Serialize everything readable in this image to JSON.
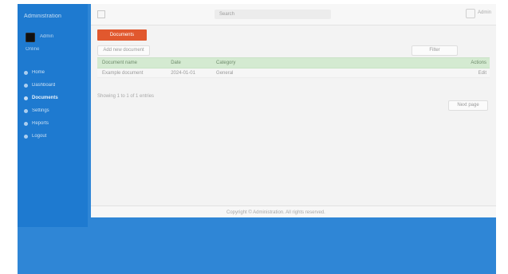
{
  "app": {
    "brand": "Administration"
  },
  "user": {
    "name": "Admin",
    "sub": "Online"
  },
  "sidebar": {
    "items": [
      {
        "label": "Home"
      },
      {
        "label": "Dashboard"
      },
      {
        "label": "Documents"
      },
      {
        "label": "Settings"
      },
      {
        "label": "Reports"
      },
      {
        "label": "Logout"
      }
    ]
  },
  "topbar": {
    "search_placeholder": "Search",
    "right_text": "Admin"
  },
  "page": {
    "title": "Documents",
    "link": "Add new document",
    "filter": "Filter",
    "footer_link": "Showing 1 to 1 of 1 entries",
    "pager": "Next page"
  },
  "table": {
    "headers": [
      "Document name",
      "Date",
      "Category",
      "Actions"
    ],
    "rows": [
      [
        "Example document",
        "2024-01-01",
        "General",
        "Edit"
      ]
    ]
  },
  "footer": {
    "copyright": "Copyright © Administration. All rights reserved."
  }
}
